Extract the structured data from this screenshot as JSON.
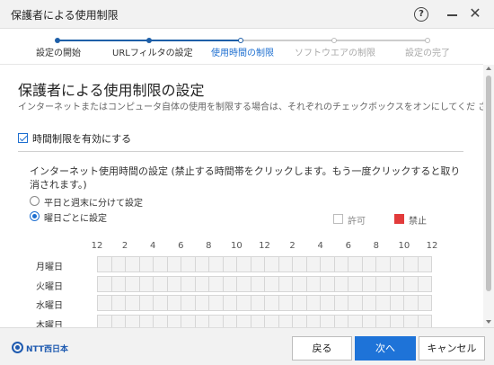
{
  "window": {
    "title": "保護者による使用制限",
    "help_icon": "?",
    "close_icon": "✕"
  },
  "steps": [
    {
      "label": "設定の開始",
      "state": "done"
    },
    {
      "label": "URLフィルタの設定",
      "state": "done"
    },
    {
      "label": "使用時間の制限",
      "state": "active"
    },
    {
      "label": "ソフトウエアの制限",
      "state": "todo"
    },
    {
      "label": "設定の完了",
      "state": "todo"
    }
  ],
  "colors": {
    "accent": "#1e6fd0",
    "deny": "#e23b3b",
    "step_done": "#1e5fa8",
    "step_todo": "#cccccc"
  },
  "main": {
    "heading": "保護者による使用制限の設定",
    "description": "インターネットまたはコンピュータ自体の使用を制限する場合は、それぞれのチェックボックスをオンにしてくだ さい。",
    "enable_time_limit": {
      "label": "時間制限を有効にする",
      "checked": true
    },
    "internet_time_desc": "インターネット使用時間の設定 (禁止する時間帯をクリックします。もう一度クリックすると取り消されます。)",
    "radio_options": [
      {
        "label": "平日と週末に分けて設定",
        "selected": false
      },
      {
        "label": "曜日ごとに設定",
        "selected": true
      }
    ],
    "legend": {
      "allow": "許可",
      "deny": "禁止"
    },
    "hour_ticks": [
      "12",
      "2",
      "4",
      "6",
      "8",
      "10",
      "12",
      "2",
      "4",
      "6",
      "8",
      "10",
      "12"
    ],
    "days": [
      "月曜日",
      "火曜日",
      "水曜日",
      "木曜日"
    ]
  },
  "footer": {
    "logo_text": "NTT西日本",
    "back": "戻る",
    "next": "次へ",
    "cancel": "キャンセル"
  }
}
